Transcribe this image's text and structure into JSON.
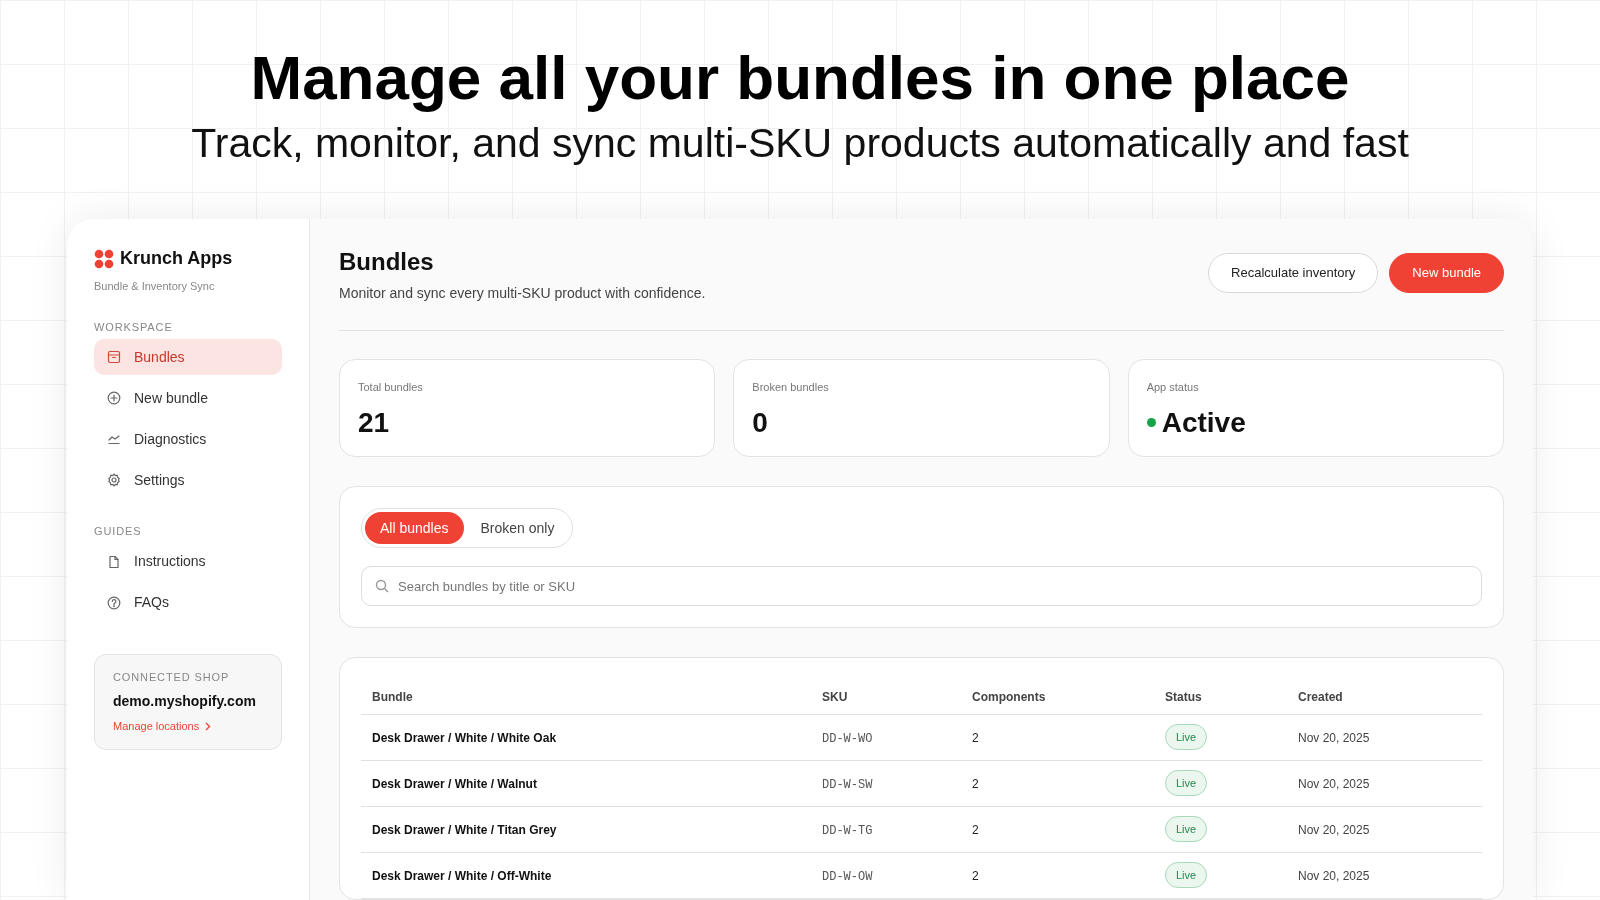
{
  "headline": "Manage all your bundles in one place",
  "subheadline": "Track, monitor, and sync multi-SKU products automatically and fast",
  "sidebar": {
    "brand": "Krunch Apps",
    "tagline": "Bundle & Inventory Sync",
    "sections": [
      {
        "heading": "WORKSPACE",
        "items": [
          {
            "label": "Bundles",
            "selected": true
          },
          {
            "label": "New bundle",
            "selected": false
          },
          {
            "label": "Diagnostics",
            "selected": false
          },
          {
            "label": "Settings",
            "selected": false
          }
        ]
      },
      {
        "heading": "GUIDES",
        "items": [
          {
            "label": "Instructions",
            "selected": false
          },
          {
            "label": "FAQs",
            "selected": false
          }
        ]
      }
    ],
    "shop": {
      "heading": "CONNECTED SHOP",
      "domain": "demo.myshopify.com",
      "link": "Manage locations"
    }
  },
  "page": {
    "title": "Bundles",
    "subtitle": "Monitor and sync every multi-SKU product with confidence.",
    "buttons": [
      {
        "label": "Recalculate inventory",
        "kind": "secondary"
      },
      {
        "label": "New bundle",
        "kind": "primary"
      }
    ]
  },
  "stats": [
    {
      "label": "Total bundles",
      "value": "21"
    },
    {
      "label": "Broken bundles",
      "value": "0"
    },
    {
      "label": "App status",
      "value": "Active",
      "color": "#16a34a"
    }
  ],
  "filters": {
    "tabs": [
      {
        "label": "All bundles",
        "selected": true
      },
      {
        "label": "Broken only",
        "selected": false
      }
    ],
    "search": {
      "placeholder": "Search bundles by title or SKU"
    }
  },
  "table": {
    "columns": [
      "Bundle",
      "SKU",
      "Components",
      "Status",
      "Created"
    ],
    "rows": [
      {
        "bundle": "Desk Drawer / White / White Oak",
        "sku": "DD-W-WO",
        "components": "2",
        "status": "Live",
        "kind": "live",
        "created": "Nov 20, 2025"
      },
      {
        "bundle": "Desk Drawer / White / Walnut",
        "sku": "DD-W-SW",
        "components": "2",
        "status": "Live",
        "kind": "live",
        "created": "Nov 20, 2025"
      },
      {
        "bundle": "Desk Drawer / White / Titan Grey",
        "sku": "DD-W-TG",
        "components": "2",
        "status": "Live",
        "kind": "live",
        "created": "Nov 20, 2025"
      },
      {
        "bundle": "Desk Drawer / White / Off-White",
        "sku": "DD-W-OW",
        "components": "2",
        "status": "Live",
        "kind": "live",
        "created": "Nov 20, 2025"
      }
    ]
  }
}
